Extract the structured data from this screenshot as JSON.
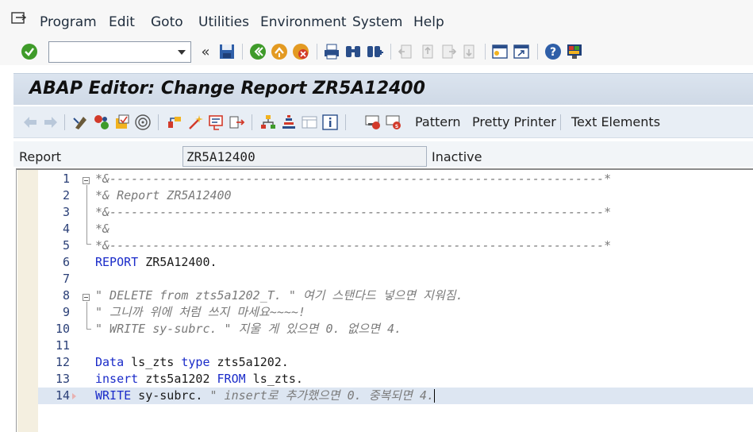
{
  "menu": {
    "items": [
      {
        "label": "Program"
      },
      {
        "label": "Edit"
      },
      {
        "label": "Goto"
      },
      {
        "label": "Utilities"
      },
      {
        "label": "Environment"
      },
      {
        "label": "System"
      },
      {
        "label": "Help"
      }
    ]
  },
  "toolbar": {
    "command_field_value": "",
    "icons": [
      "enter-icon",
      "back-icon",
      "save-icon",
      "back-nav-icon",
      "exit-icon",
      "cancel-icon",
      "print-icon",
      "find-icon",
      "find-next-icon",
      "first-page-icon",
      "prev-page-icon",
      "next-page-icon",
      "last-page-icon",
      "new-session-icon",
      "shortcut-icon",
      "help-icon",
      "customize-layout-icon"
    ]
  },
  "title": "ABAP Editor: Change Report ZR5A12400",
  "app_toolbar": {
    "pattern_label": "Pattern",
    "pretty_printer_label": "Pretty Printer",
    "text_elements_label": "Text Elements"
  },
  "report": {
    "label": "Report",
    "value": "ZR5A12400",
    "status": "Inactive"
  },
  "editor": {
    "lines": [
      {
        "num": "1",
        "segments": [
          {
            "cls": "cmt",
            "text": "*&---------------------------------------------------------------------*"
          }
        ]
      },
      {
        "num": "2",
        "segments": [
          {
            "cls": "cmt",
            "text": "*& Report ZR5A12400"
          }
        ]
      },
      {
        "num": "3",
        "segments": [
          {
            "cls": "cmt",
            "text": "*&---------------------------------------------------------------------*"
          }
        ]
      },
      {
        "num": "4",
        "segments": [
          {
            "cls": "cmt",
            "text": "*&"
          }
        ]
      },
      {
        "num": "5",
        "segments": [
          {
            "cls": "cmt",
            "text": "*&---------------------------------------------------------------------*"
          }
        ]
      },
      {
        "num": "6",
        "segments": [
          {
            "cls": "kw",
            "text": "REPORT"
          },
          {
            "cls": "plain",
            "text": " ZR5A12400."
          }
        ]
      },
      {
        "num": "7",
        "segments": []
      },
      {
        "num": "8",
        "segments": [
          {
            "cls": "cmt",
            "text": "\" DELETE from zts5a1202_T. \" 여기 스탠다드 넣으면 지워짐."
          }
        ]
      },
      {
        "num": "9",
        "segments": [
          {
            "cls": "cmt",
            "text": "\" 그니까 위에 처럼 쓰지 마세요~~~~!"
          }
        ]
      },
      {
        "num": "10",
        "segments": [
          {
            "cls": "cmt",
            "text": "\" WRITE sy-subrc. \" 지울 게 있으면 0. 없으면 4."
          }
        ]
      },
      {
        "num": "11",
        "segments": []
      },
      {
        "num": "12",
        "segments": [
          {
            "cls": "kw",
            "text": "Data"
          },
          {
            "cls": "plain",
            "text": " ls_zts "
          },
          {
            "cls": "kw",
            "text": "type"
          },
          {
            "cls": "plain",
            "text": " zts5a1202."
          }
        ]
      },
      {
        "num": "13",
        "segments": [
          {
            "cls": "kw",
            "text": "insert"
          },
          {
            "cls": "plain",
            "text": " zts5a1202 "
          },
          {
            "cls": "kw",
            "text": "FROM"
          },
          {
            "cls": "plain",
            "text": " ls_zts."
          }
        ]
      },
      {
        "num": "14",
        "segments": [
          {
            "cls": "kw",
            "text": "WRITE"
          },
          {
            "cls": "plain",
            "text": " sy-subrc. "
          },
          {
            "cls": "cmt",
            "text": "\" insert로 추가했으면 0. 중복되면 4."
          }
        ]
      }
    ]
  }
}
